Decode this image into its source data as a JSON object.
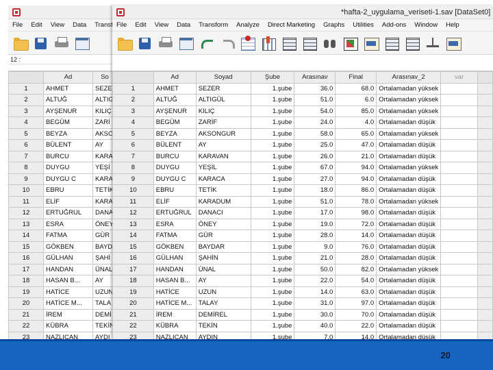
{
  "window_back": {
    "menu": [
      "File",
      "Edit",
      "View",
      "Data",
      "Transf"
    ],
    "cell_ref": "12 :",
    "headers": [
      "Ad",
      "So"
    ],
    "rows": [
      [
        "1",
        "AHMET",
        "SEZE"
      ],
      [
        "2",
        "ALTUĞ",
        "ALTIG"
      ],
      [
        "3",
        "AYŞENUR",
        "KILIÇ"
      ],
      [
        "4",
        "BEGÜM",
        "ZARİ"
      ],
      [
        "5",
        "BEYZA",
        "AKSO"
      ],
      [
        "6",
        "BÜLENT",
        "AY"
      ],
      [
        "7",
        "BURCU",
        "KARA"
      ],
      [
        "8",
        "DUYGU",
        "YEŞİ"
      ],
      [
        "9",
        "DUYGU C",
        "KARA"
      ],
      [
        "10",
        "EBRU",
        "TETİK"
      ],
      [
        "11",
        "ELİF",
        "KARA"
      ],
      [
        "12",
        "ERTUĞRUL",
        "DANA"
      ],
      [
        "13",
        "ESRA",
        "ÖNEY"
      ],
      [
        "14",
        "FATMA",
        "GÜR"
      ],
      [
        "15",
        "GÖKBEN",
        "BAYD"
      ],
      [
        "16",
        "GÜLHAN",
        "ŞAHİ"
      ],
      [
        "17",
        "HANDAN",
        "ÜNAL"
      ],
      [
        "18",
        "HASAN B...",
        "AY"
      ],
      [
        "19",
        "HATİCE",
        "UZUN"
      ],
      [
        "20",
        "HATİCE M...",
        "TALA"
      ],
      [
        "21",
        "İREM",
        "DEMİ"
      ],
      [
        "22",
        "KÜBRA",
        "TEKİN"
      ],
      [
        "23",
        "NAZLICAN",
        "AYDI"
      ]
    ]
  },
  "window_front": {
    "title": "*hafta-2_uygulama_veriseti-1.sav [DataSet0] -",
    "menu": [
      "File",
      "Edit",
      "View",
      "Data",
      "Transform",
      "Analyze",
      "Direct Marketing",
      "Graphs",
      "Utilities",
      "Add-ons",
      "Window",
      "Help"
    ],
    "toolbar_icons": [
      "folder-open-icon",
      "save-icon",
      "print-icon",
      "dialog-recall-icon",
      "undo-icon",
      "redo-icon",
      "goto-case-icon",
      "insert-variable-icon",
      "grid-icon",
      "grid-icon",
      "binoculars-icon",
      "split-file-icon",
      "labels-icon",
      "grid-icon",
      "grid-icon",
      "weight-cases-icon",
      "value-labels-icon"
    ],
    "headers": [
      "Ad",
      "Soyad",
      "Şube",
      "Arasınav",
      "Final",
      "Arasınav_2",
      "var"
    ],
    "rows": [
      [
        "1",
        "AHMET",
        "SEZER",
        "1.şube",
        "36.0",
        "68.0",
        "Ortalamadan yüksek"
      ],
      [
        "2",
        "ALTUĞ",
        "ALTIGÜL",
        "1.şube",
        "51.0",
        "6.0",
        "Ortalamadan yüksek"
      ],
      [
        "3",
        "AYŞENUR",
        "KILIÇ",
        "1.şube",
        "54.0",
        "85.0",
        "Ortalamadan yüksek"
      ],
      [
        "4",
        "BEGÜM",
        "ZARİF",
        "1.şube",
        "24.0",
        "4.0",
        "Ortalamadan düşük"
      ],
      [
        "5",
        "BEYZA",
        "AKSONGUR",
        "1.şube",
        "58.0",
        "65.0",
        "Ortalamadan yüksek"
      ],
      [
        "6",
        "BÜLENT",
        "AY",
        "1.şube",
        "25.0",
        "47.0",
        "Ortalamadan düşük"
      ],
      [
        "7",
        "BURCU",
        "KARAVAN",
        "1.şube",
        "26.0",
        "21.0",
        "Ortalamadan düşük"
      ],
      [
        "8",
        "DUYGU",
        "YEŞİL",
        "1.şube",
        "67.0",
        "94.0",
        "Ortalamadan yüksek"
      ],
      [
        "9",
        "DUYGU C",
        "KARACA",
        "1.şube",
        "27.0",
        "94.0",
        "Ortalamadan düşük"
      ],
      [
        "10",
        "EBRU",
        "TETİK",
        "1.şube",
        "18.0",
        "86.0",
        "Ortalamadan düşük"
      ],
      [
        "11",
        "ELİF",
        "KARADUM",
        "1.şube",
        "51.0",
        "78.0",
        "Ortalamadan yüksek"
      ],
      [
        "12",
        "ERTUĞRUL",
        "DANACI",
        "1.şube",
        "17.0",
        "98.0",
        "Ortalamadan düşük"
      ],
      [
        "13",
        "ESRA",
        "ÖNEY",
        "1.şube",
        "19.0",
        "72.0",
        "Ortalamadan düşük"
      ],
      [
        "14",
        "FATMA",
        "GÜR",
        "1.şube",
        "28.0",
        "14.0",
        "Ortalamadan düşük"
      ],
      [
        "15",
        "GÖKBEN",
        "BAYDAR",
        "1.şube",
        "9.0",
        "76.0",
        "Ortalamadan düşük"
      ],
      [
        "16",
        "GÜLHAN",
        "ŞAHİN",
        "1.şube",
        "21.0",
        "28.0",
        "Ortalamadan düşük"
      ],
      [
        "17",
        "HANDAN",
        "ÜNAL",
        "1.şube",
        "50.0",
        "82.0",
        "Ortalamadan yüksek"
      ],
      [
        "18",
        "HASAN B...",
        "AY",
        "1.şube",
        "22.0",
        "54.0",
        "Ortalamadan düşük"
      ],
      [
        "19",
        "HATİCE",
        "UZUN",
        "1.şube",
        "14.0",
        "63.0",
        "Ortalamadan düşük"
      ],
      [
        "20",
        "HATİCE M...",
        "TALAY",
        "1.şube",
        "31.0",
        "97.0",
        "Ortalamadan düşük"
      ],
      [
        "21",
        "İREM",
        "DEMİREL",
        "1.şube",
        "30.0",
        "70.0",
        "Ortalamadan düşük"
      ],
      [
        "22",
        "KÜBRA",
        "TEKİN",
        "1.şube",
        "40.0",
        "22.0",
        "Ortalamadan düşük"
      ],
      [
        "23",
        "NAZLICAN",
        "AYDIN",
        "1.şube",
        "7.0",
        "14.0",
        "Ortalamadan düşük"
      ]
    ]
  },
  "slide": {
    "page_number": "20",
    "footer_color": "#1565c0"
  }
}
